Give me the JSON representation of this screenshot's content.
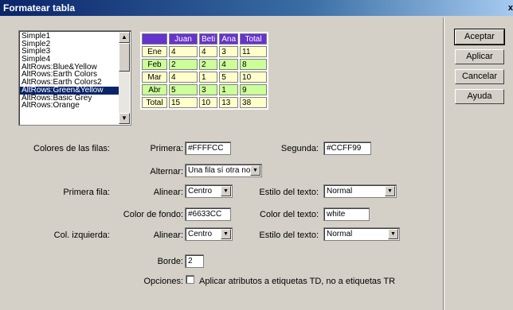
{
  "window": {
    "title": "Formatear tabla",
    "close": "x"
  },
  "styles_list": {
    "items": [
      "Simple1",
      "Simple2",
      "Simple3",
      "Simple4",
      "AltRows:Blue&Yellow",
      "AltRows:Earth Colors",
      "AltRows:Earth Colors2",
      "AltRows:Green&Yellow",
      "AltRows:Basic Grey",
      "AltRows:Orange"
    ],
    "selected": "AltRows:Green&Yellow"
  },
  "preview": {
    "header": [
      "",
      "Juan",
      "Beti",
      "Ana",
      "Total"
    ],
    "rows": [
      [
        "Ene",
        "4",
        "4",
        "3",
        "11"
      ],
      [
        "Feb",
        "2",
        "2",
        "4",
        "8"
      ],
      [
        "Mar",
        "4",
        "1",
        "5",
        "10"
      ],
      [
        "Abr",
        "5",
        "3",
        "1",
        "9"
      ],
      [
        "Total",
        "15",
        "10",
        "13",
        "38"
      ]
    ]
  },
  "buttons": {
    "ok": "Aceptar",
    "apply": "Aplicar",
    "cancel": "Cancelar",
    "help": "Ayuda"
  },
  "row_colors": {
    "label": "Colores de las filas:",
    "first_label": "Primera:",
    "first_value": "#FFFFCC",
    "second_label": "Segunda:",
    "second_value": "#CCFF99",
    "alternate_label": "Alternar:",
    "alternate_value": "Una fila sí otra no"
  },
  "first_row": {
    "label": "Primera fila:",
    "align_label": "Alinear:",
    "align_value": "Centro",
    "text_style_label": "Estilo del texto:",
    "text_style_value": "Normal",
    "bg_color_label": "Color de fondo:",
    "bg_color_value": "#6633CC",
    "text_color_label": "Color del texto:",
    "text_color_value": "white"
  },
  "left_col": {
    "label": "Col. izquierda:",
    "align_label": "Alinear:",
    "align_value": "Centro",
    "text_style_label": "Estilo del texto:",
    "text_style_value": "Normal"
  },
  "border": {
    "label": "Borde:",
    "value": "2"
  },
  "options": {
    "label": "Opciones:",
    "checkbox_label": "Aplicar atributos a etiquetas TD, no a etiquetas TR",
    "checked": false
  },
  "icons": {
    "scroll_up": "▲",
    "scroll_down": "▼",
    "dropdown": "▼"
  }
}
